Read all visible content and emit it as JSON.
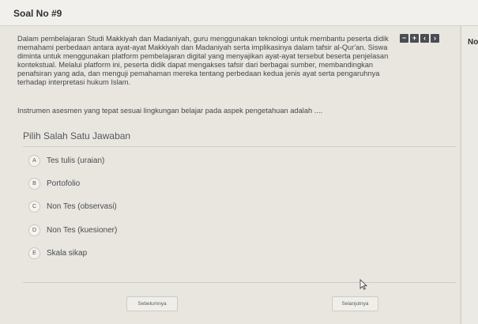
{
  "header": {
    "title": "Soal No #9"
  },
  "side": {
    "label": "No"
  },
  "toolbar": {
    "buttons": [
      {
        "name": "minus",
        "glyph": "−"
      },
      {
        "name": "plus",
        "glyph": "+"
      },
      {
        "name": "prev",
        "glyph": "‹"
      },
      {
        "name": "next",
        "glyph": "›"
      }
    ]
  },
  "question": {
    "text": "Dalam pembelajaran Studi Makkiyah dan Madaniyah, guru menggunakan teknologi untuk membantu peserta didik memahami perbedaan antara ayat-ayat Makkiyah dan Madaniyah serta implikasinya dalam tafsir al-Qur'an. Siswa diminta untuk menggunakan platform pembelajaran digital yang menyajikan ayat-ayat tersebut beserta penjelasan kontekstual. Melalui platform ini, peserta didik dapat mengakses tafsir dari berbagai sumber, membandingkan penafsiran yang ada, dan menguji pemahaman mereka tentang perbedaan kedua jenis ayat serta pengaruhnya terhadap interpretasi hukum Islam.",
    "prompt": "Instrumen asesmen yang tepat sesuai lingkungan belajar pada aspek pengetahuan adalah ...."
  },
  "answers": {
    "heading": "Pilih Salah Satu Jawaban",
    "options": [
      {
        "letter": "A",
        "text": "Tes tulis (uraian)"
      },
      {
        "letter": "B",
        "text": "Portofolio"
      },
      {
        "letter": "C",
        "text": "Non Tes (observasi)"
      },
      {
        "letter": "D",
        "text": "Non Tes (kuesioner)"
      },
      {
        "letter": "E",
        "text": "Skala sikap"
      }
    ]
  },
  "navigation": {
    "prev_label": "Sebelumnya",
    "next_label": "Selanjutnya"
  }
}
